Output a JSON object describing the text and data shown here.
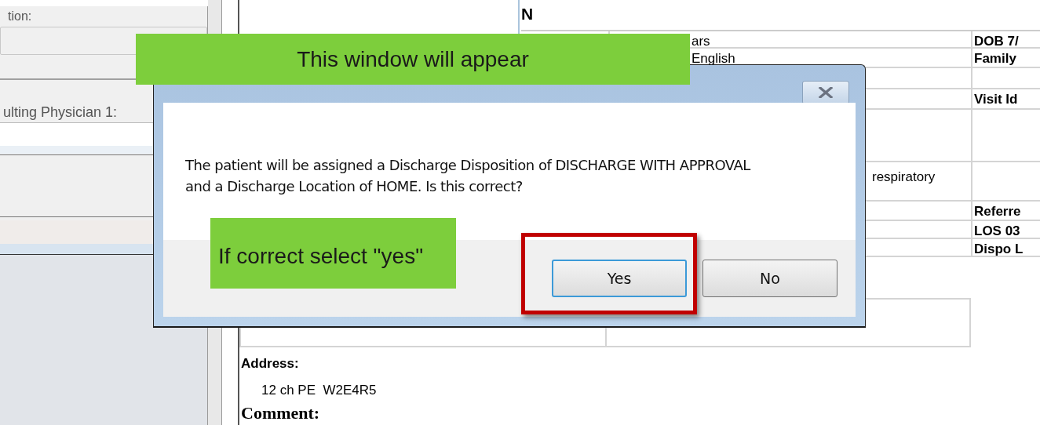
{
  "left_panel": {
    "field_labels": [
      "tion:",
      "ulting Physician 1:"
    ]
  },
  "document": {
    "heading": "N",
    "summary_table": {
      "rows": [
        {
          "cells": [
            "",
            "ars",
            "DOB 7/"
          ]
        },
        {
          "cells": [
            "",
            "English",
            "Family"
          ]
        },
        {
          "cells": [
            "",
            "",
            ""
          ]
        },
        {
          "cells": [
            "",
            "",
            "Visit Id"
          ]
        },
        {
          "cells": [
            "",
            "",
            ""
          ]
        },
        {
          "cells": [
            "",
            "respiratory",
            ""
          ]
        },
        {
          "cells": [
            "",
            "",
            "Referre"
          ]
        },
        {
          "cells": [
            "",
            "",
            "LOS 03"
          ]
        },
        {
          "cells": [
            "",
            "",
            "Dispo L"
          ]
        }
      ]
    },
    "address_label": "Address:",
    "address": "12 ch PE  W2E4R5",
    "comment_label": "Comment:"
  },
  "dialog": {
    "message": "The patient will be assigned a Discharge Disposition of DISCHARGE WITH APPROVAL and a Discharge Location of HOME. Is this correct?",
    "buttons": [
      {
        "label": "Yes",
        "focused": true,
        "highlighted": true
      },
      {
        "label": "No",
        "focused": false,
        "highlighted": false
      }
    ]
  },
  "callouts": [
    {
      "kind": "top",
      "text": "This window will appear"
    },
    {
      "kind": "footer",
      "text": "If correct select \"yes\""
    }
  ]
}
